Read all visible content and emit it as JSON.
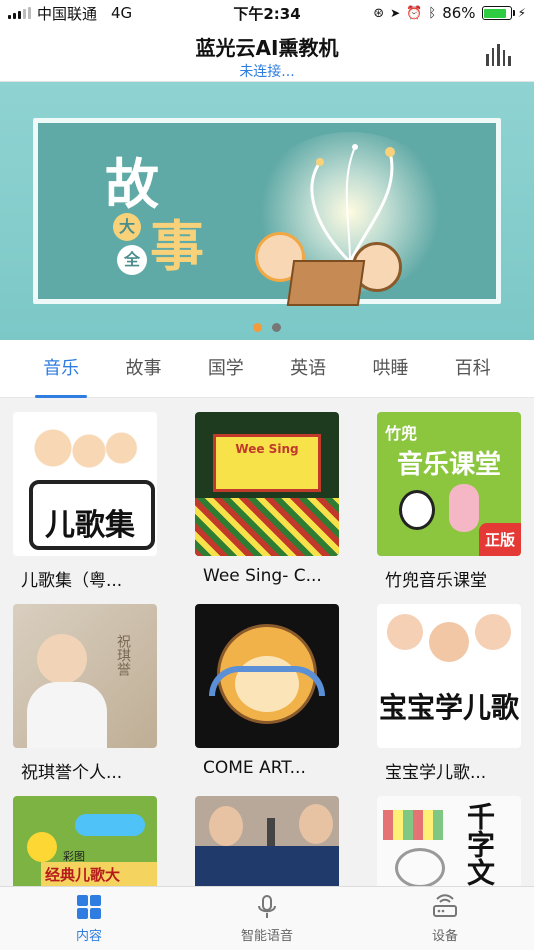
{
  "status_bar": {
    "carrier": "中国联通",
    "network": "4G",
    "time": "下午2:34",
    "battery": "86%",
    "battery_level": 0.86
  },
  "header": {
    "title": "蓝光云AI熏教机",
    "subtitle": "未连接..."
  },
  "banner": {
    "char_gu": "故",
    "char_shi": "事",
    "char_da": "大",
    "char_quan": "全",
    "page_count": 2,
    "active_page": 1
  },
  "tabs": [
    {
      "label": "音乐",
      "active": true
    },
    {
      "label": "故事",
      "active": false
    },
    {
      "label": "国学",
      "active": false
    },
    {
      "label": "英语",
      "active": false
    },
    {
      "label": "哄睡",
      "active": false
    },
    {
      "label": "百科",
      "active": false
    }
  ],
  "albums": [
    {
      "title": "儿歌集（粤...",
      "cover_text": "儿歌集"
    },
    {
      "title": "Wee Sing- C...",
      "cover_text": "Wee Sing"
    },
    {
      "title": "竹兜音乐课堂",
      "cover_text": "音乐课堂",
      "cover_badge": "正版",
      "cover_brand": "竹兜"
    },
    {
      "title": "祝琪誉个人...",
      "cover_text": "祝琪誉"
    },
    {
      "title": "COME ART...",
      "cover_text": ""
    },
    {
      "title": "宝宝学儿歌...",
      "cover_text": "宝宝学儿歌"
    },
    {
      "title": "",
      "cover_text": "经典儿歌大",
      "cover_brand": "彩图"
    },
    {
      "title": "",
      "cover_text": ""
    },
    {
      "title": "",
      "cover_text": "千字文"
    }
  ],
  "bottom_tabs": [
    {
      "label": "内容",
      "icon": "grid-icon",
      "active": true
    },
    {
      "label": "智能语音",
      "icon": "microphone-icon",
      "active": false
    },
    {
      "label": "设备",
      "icon": "router-icon",
      "active": false
    }
  ],
  "colors": {
    "accent": "#2f7de1",
    "banner_bg": "#8fd3d2",
    "active_dot": "#f39a3a"
  }
}
